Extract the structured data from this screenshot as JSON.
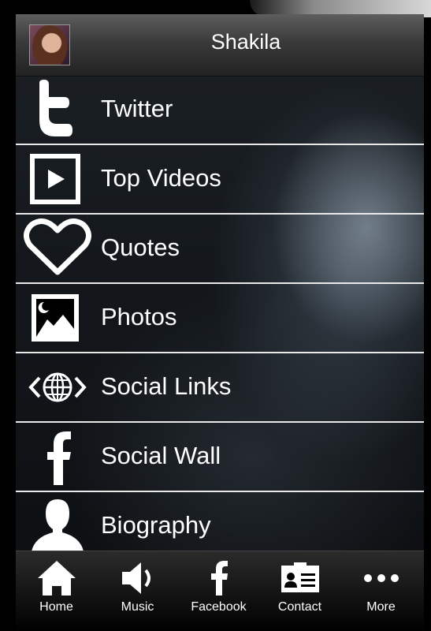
{
  "header": {
    "title": "Shakila"
  },
  "menu": {
    "items": [
      {
        "label": "Twitter",
        "icon": "twitter-icon"
      },
      {
        "label": "Top Videos",
        "icon": "video-play-icon"
      },
      {
        "label": "Quotes",
        "icon": "heart-icon"
      },
      {
        "label": "Photos",
        "icon": "photo-icon"
      },
      {
        "label": "Social Links",
        "icon": "globe-icon"
      },
      {
        "label": "Social Wall",
        "icon": "facebook-icon"
      },
      {
        "label": "Biography",
        "icon": "person-icon"
      }
    ]
  },
  "tabbar": {
    "tabs": [
      {
        "label": "Home",
        "icon": "home-icon"
      },
      {
        "label": "Music",
        "icon": "speaker-icon"
      },
      {
        "label": "Facebook",
        "icon": "facebook-icon"
      },
      {
        "label": "Contact",
        "icon": "contact-card-icon"
      },
      {
        "label": "More",
        "icon": "more-dots-icon"
      }
    ]
  }
}
